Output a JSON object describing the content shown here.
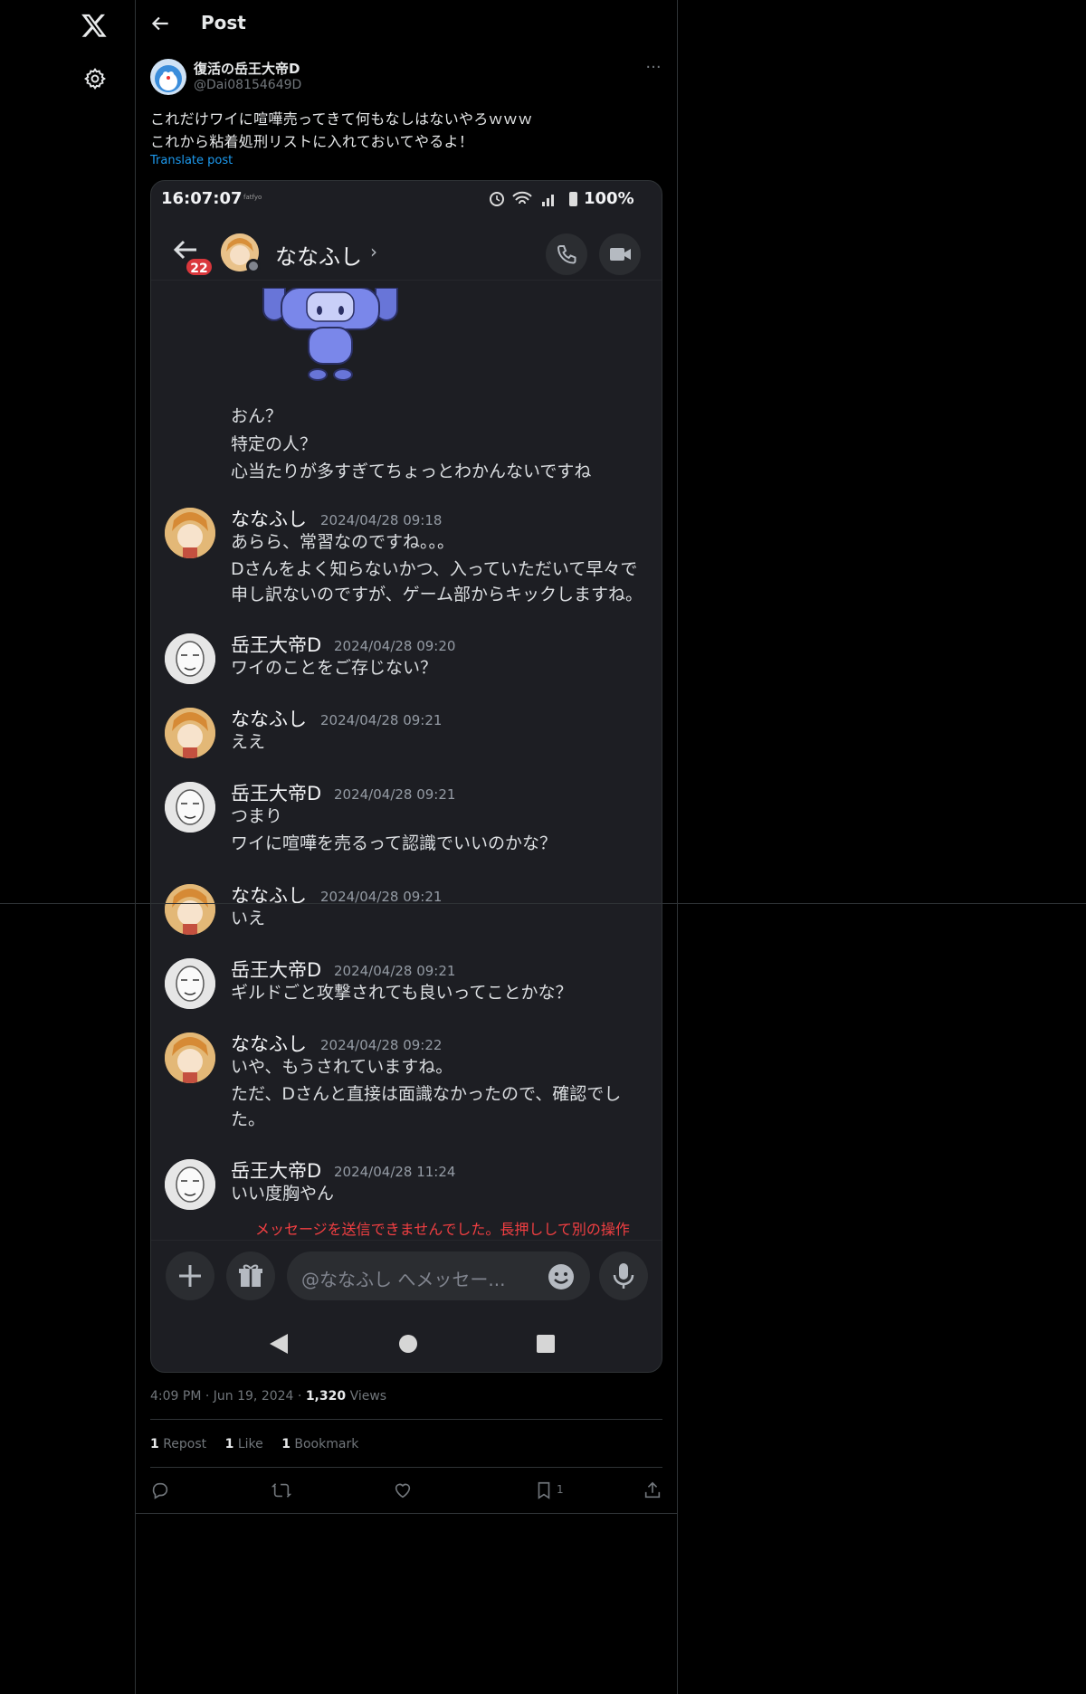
{
  "header": {
    "title": "Post"
  },
  "author": {
    "name": "復活の岳王大帝D",
    "handle": "@Dai08154649D"
  },
  "post": {
    "lines": [
      "これだけワイに喧嘩売ってきて何もなしはないやろｗｗｗ",
      "これから粘着処刑リストに入れておいてやるよ！"
    ],
    "translate": "Translate post"
  },
  "screenshot": {
    "status": {
      "time": "16:07:07",
      "small": "fatfyo",
      "battery": "100%"
    },
    "chat_header": {
      "badge": "22",
      "name": "ななふし",
      "chevron": "›"
    },
    "intro_lines": [
      "おん？",
      "特定の人？",
      "心当たりが多すぎてちょっとわかんないですね"
    ],
    "messages": [
      {
        "author": "ななふし",
        "time": "2024/04/28 09:18",
        "lines": [
          "あらら、常習なのですね。。。",
          "Dさんをよく知らないかつ、入っていただいて早々で",
          "申し訳ないのですが、ゲーム部からキックしますね。"
        ]
      },
      {
        "author": "岳王大帝D",
        "time": "2024/04/28 09:20",
        "lines": [
          "ワイのことをご存じない？"
        ]
      },
      {
        "author": "ななふし",
        "time": "2024/04/28 09:21",
        "lines": [
          "ええ"
        ]
      },
      {
        "author": "岳王大帝D",
        "time": "2024/04/28 09:21",
        "lines": [
          "つまり",
          "ワイに喧嘩を売るって認識でいいのかな？"
        ]
      },
      {
        "author": "ななふし",
        "time": "2024/04/28 09:21",
        "lines": [
          "いえ"
        ]
      },
      {
        "author": "岳王大帝D",
        "time": "2024/04/28 09:21",
        "lines": [
          "ギルドごと攻撃されても良いってことかな？"
        ]
      },
      {
        "author": "ななふし",
        "time": "2024/04/28 09:22",
        "lines": [
          "いや、もうされていますね。",
          "ただ、Dさんと直接は面識なかったので、確認でし",
          "た。"
        ]
      },
      {
        "author": "岳王大帝D",
        "time": "2024/04/28 11:24",
        "lines": [
          "いい度胸やん"
        ]
      }
    ],
    "error": "メッセージを送信できませんでした。長押しして別の操作",
    "input_placeholder": "@ななふし へメッセー..."
  },
  "meta": {
    "time": "4:09 PM",
    "sep1": "·",
    "date": "Jun 19, 2024",
    "sep2": "·",
    "views_count": "1,320",
    "views_label": "Views"
  },
  "stats": {
    "reposts": "1",
    "reposts_label": "Repost",
    "likes": "1",
    "likes_label": "Like",
    "bookmarks": "1",
    "bookmarks_label": "Bookmark"
  },
  "actions": {
    "bookmark_count": "1"
  },
  "icons": [
    "x-logo-icon",
    "gear-icon",
    "arrow-left-icon",
    "more-icon",
    "reply-icon",
    "repost-icon",
    "heart-icon",
    "bookmark-icon",
    "share-icon"
  ]
}
